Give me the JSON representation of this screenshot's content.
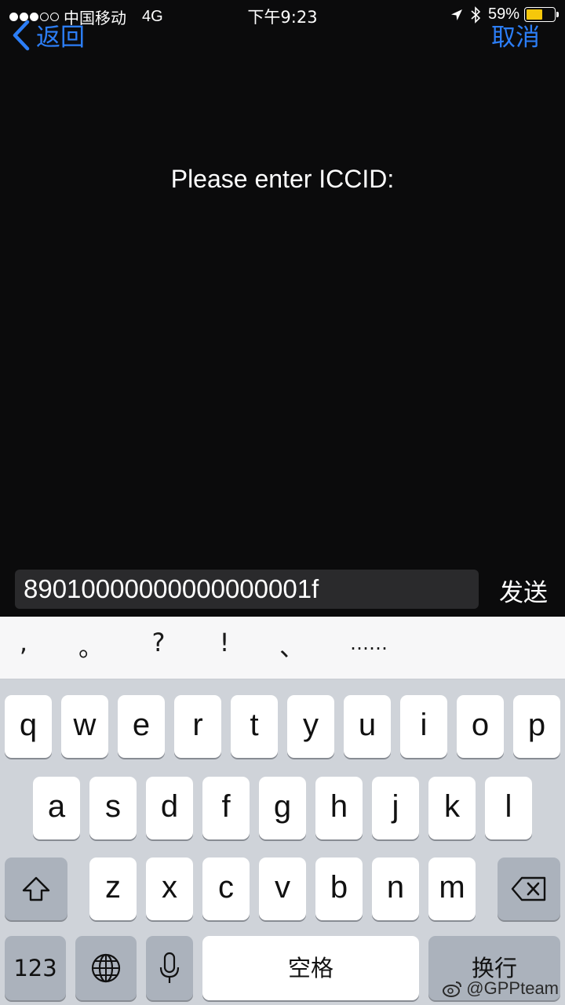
{
  "status_bar": {
    "carrier": "中国移动",
    "network": "4G",
    "time": "下午9:23",
    "battery_percent": "59%",
    "battery_level": 0.59,
    "signal_bars_filled": 3,
    "signal_bars_total": 5
  },
  "nav": {
    "back_label": "返回",
    "cancel_label": "取消",
    "accent_color": "#2c7ef7"
  },
  "prompt": {
    "text": "Please enter ICCID:"
  },
  "input": {
    "value": "89010000000000000001f",
    "send_label": "发送"
  },
  "suggestions": [
    ",",
    "。",
    "?",
    "!",
    "、",
    "……"
  ],
  "keyboard": {
    "row1": [
      "q",
      "w",
      "e",
      "r",
      "t",
      "y",
      "u",
      "i",
      "o",
      "p"
    ],
    "row2": [
      "a",
      "s",
      "d",
      "f",
      "g",
      "h",
      "j",
      "k",
      "l"
    ],
    "row3": [
      "z",
      "x",
      "c",
      "v",
      "b",
      "n",
      "m"
    ],
    "numbers_label": "123",
    "space_label": "空格",
    "return_label": "换行",
    "icons": {
      "shift": "shift-icon",
      "delete": "backspace-icon",
      "globe": "globe-icon",
      "mic": "microphone-icon"
    }
  },
  "watermark": {
    "text": "@GPPteam"
  }
}
